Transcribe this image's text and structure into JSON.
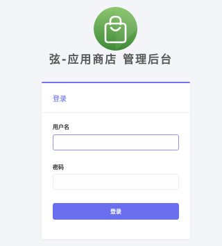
{
  "header": {
    "logo_icon": "shopping-bag-icon",
    "logo_color": "#5ea34a",
    "title": "弦-应用商店 管理后台"
  },
  "login_card": {
    "title": "登录",
    "accent_color": "#6a6ff0",
    "username": {
      "label": "用户名",
      "value": "",
      "placeholder": ""
    },
    "password": {
      "label": "密码",
      "value": "",
      "placeholder": ""
    },
    "submit_label": "登录"
  }
}
